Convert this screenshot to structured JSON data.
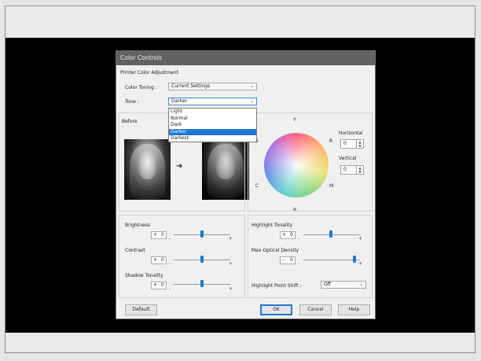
{
  "dialog": {
    "title": "Color Controls"
  },
  "adjustment": {
    "section_label": "Printer Color Adjustment",
    "color_toning_label": "Color Toning :",
    "color_toning_value": "Current Settings",
    "tone_label": "Tone :",
    "tone_value": "Darker",
    "tone_options": [
      "Light",
      "Normal",
      "Dark",
      "Darker",
      "Darkest"
    ],
    "tone_selected": "Darker"
  },
  "preview": {
    "before_label": "Before"
  },
  "wheel": {
    "labels": {
      "Y": "Y",
      "R": "R",
      "G": "G",
      "C": "C",
      "M": "M",
      "B": "B"
    },
    "horizontal_label": "Horizontal",
    "horizontal_value": "0",
    "vertical_label": "Vertical",
    "vertical_value": "0"
  },
  "sliders_left": {
    "brightness_label": "Brightness",
    "brightness_sign": "+",
    "brightness_value": "0",
    "contrast_label": "Contrast",
    "contrast_sign": "+",
    "contrast_value": "0",
    "shadow_label": "Shadow Tonality",
    "shadow_sign": "+",
    "shadow_value": "0",
    "minus": "-",
    "plus": "+"
  },
  "sliders_right": {
    "highlight_label": "Highlight Tonality",
    "highlight_sign": "+",
    "highlight_value": "0",
    "max_density_label": "Max Optical Density",
    "max_density_sign": "-",
    "max_density_value": "0",
    "shift_label": "Highlight Point Shift :",
    "shift_value": "Off"
  },
  "buttons": {
    "default": "Default",
    "ok": "OK",
    "cancel": "Cancel",
    "help": "Help"
  }
}
